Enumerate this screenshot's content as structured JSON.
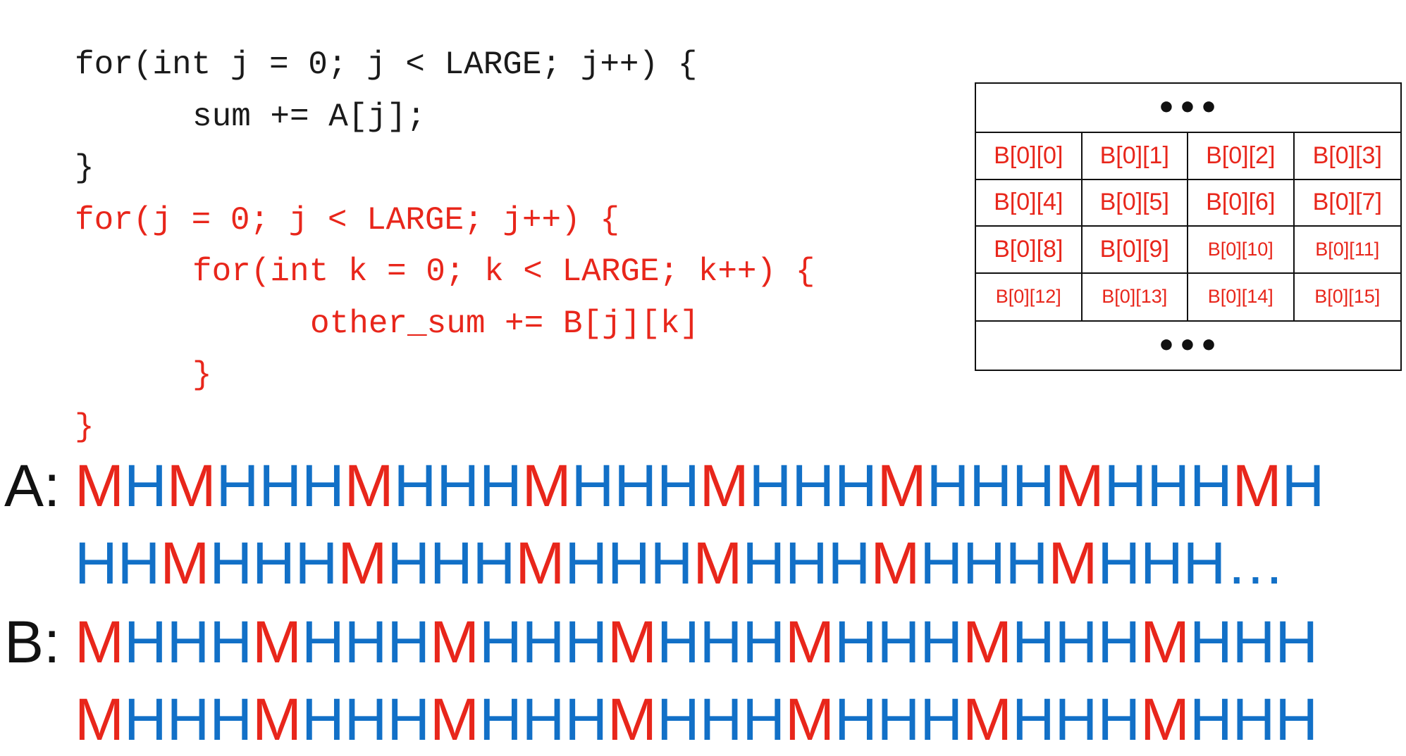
{
  "code": {
    "lines": [
      {
        "text": "for(int j = 0; j < LARGE; j++) {",
        "indent": 0,
        "color": "black"
      },
      {
        "text": "sum += A[j];",
        "indent": 1,
        "color": "black"
      },
      {
        "text": "}",
        "indent": 0,
        "color": "black"
      },
      {
        "text": "for(j = 0; j < LARGE; j++) {",
        "indent": 0,
        "color": "red"
      },
      {
        "text": "for(int k = 0; k < LARGE; k++) {",
        "indent": 1,
        "color": "red"
      },
      {
        "text": "other_sum += B[j][k]",
        "indent": 2,
        "color": "red"
      },
      {
        "text": "}",
        "indent": 1,
        "color": "red"
      },
      {
        "text": "}",
        "indent": 0,
        "color": "red"
      }
    ]
  },
  "memory_grid": {
    "top_ellipsis": "•••",
    "bottom_ellipsis": "•••",
    "cells": [
      [
        "B[0][0]",
        "B[0][1]",
        "B[0][2]",
        "B[0][3]"
      ],
      [
        "B[0][4]",
        "B[0][5]",
        "B[0][6]",
        "B[0][7]"
      ],
      [
        "B[0][8]",
        "B[0][9]",
        "B[0][10]",
        "B[0][11]"
      ],
      [
        "B[0][12]",
        "B[0][13]",
        "B[0][14]",
        "B[0][15]"
      ]
    ]
  },
  "access_patterns": {
    "a_label": "A:",
    "a_line1": "MHMHHHMHHHMHHHMHHHMHHHMHHHMH",
    "a_line2": "HHMHHHMHHHMHHHMHHHMHHHMHHH…",
    "b_label": "B:",
    "b_line1": "MHHHMHHHMHHHMHHHMHHHMHHHMHHH",
    "b_line2": "MHHHMHHHMHHHMHHHMHHHMHHHMHHH"
  },
  "colors": {
    "miss": "#e8261b",
    "hit": "#1270c7",
    "code_black": "#1a1a1a",
    "code_red": "#e8261b"
  }
}
